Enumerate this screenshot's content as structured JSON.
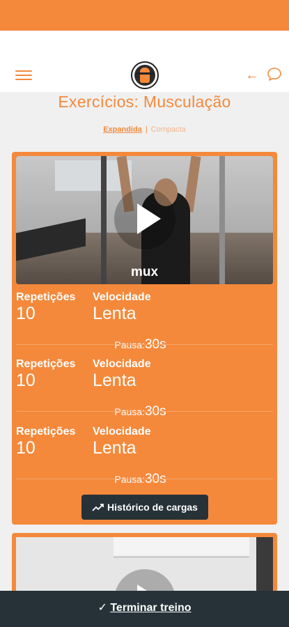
{
  "header": {
    "menu_icon": "hamburger-menu-icon",
    "logo": "gym-logo",
    "back_icon": "arrow-left-icon",
    "chat_icon": "chat-bubble-icon"
  },
  "page_title": "Exercícios: Musculação",
  "view_toggle": {
    "active": "Expandida",
    "separator": "|",
    "inactive": "Compacta"
  },
  "exercise": {
    "video_label": "mux",
    "sets": [
      {
        "reps_label": "Repetições",
        "reps_value": "10",
        "speed_label": "Velocidade",
        "speed_value": "Lenta",
        "pause_label": "Pausa:",
        "pause_value": "30s"
      },
      {
        "reps_label": "Repetições",
        "reps_value": "10",
        "speed_label": "Velocidade",
        "speed_value": "Lenta",
        "pause_label": "Pausa:",
        "pause_value": "30s"
      },
      {
        "reps_label": "Repetições",
        "reps_value": "10",
        "speed_label": "Velocidade",
        "speed_value": "Lenta",
        "pause_label": "Pausa:",
        "pause_value": "30s"
      }
    ],
    "history_button": "Histórico de cargas"
  },
  "bottom_bar": {
    "finish_check": "✓",
    "finish_label": "Terminar treino"
  },
  "colors": {
    "accent": "#f4893b",
    "dark": "#263238",
    "background": "#f0f0f0"
  }
}
